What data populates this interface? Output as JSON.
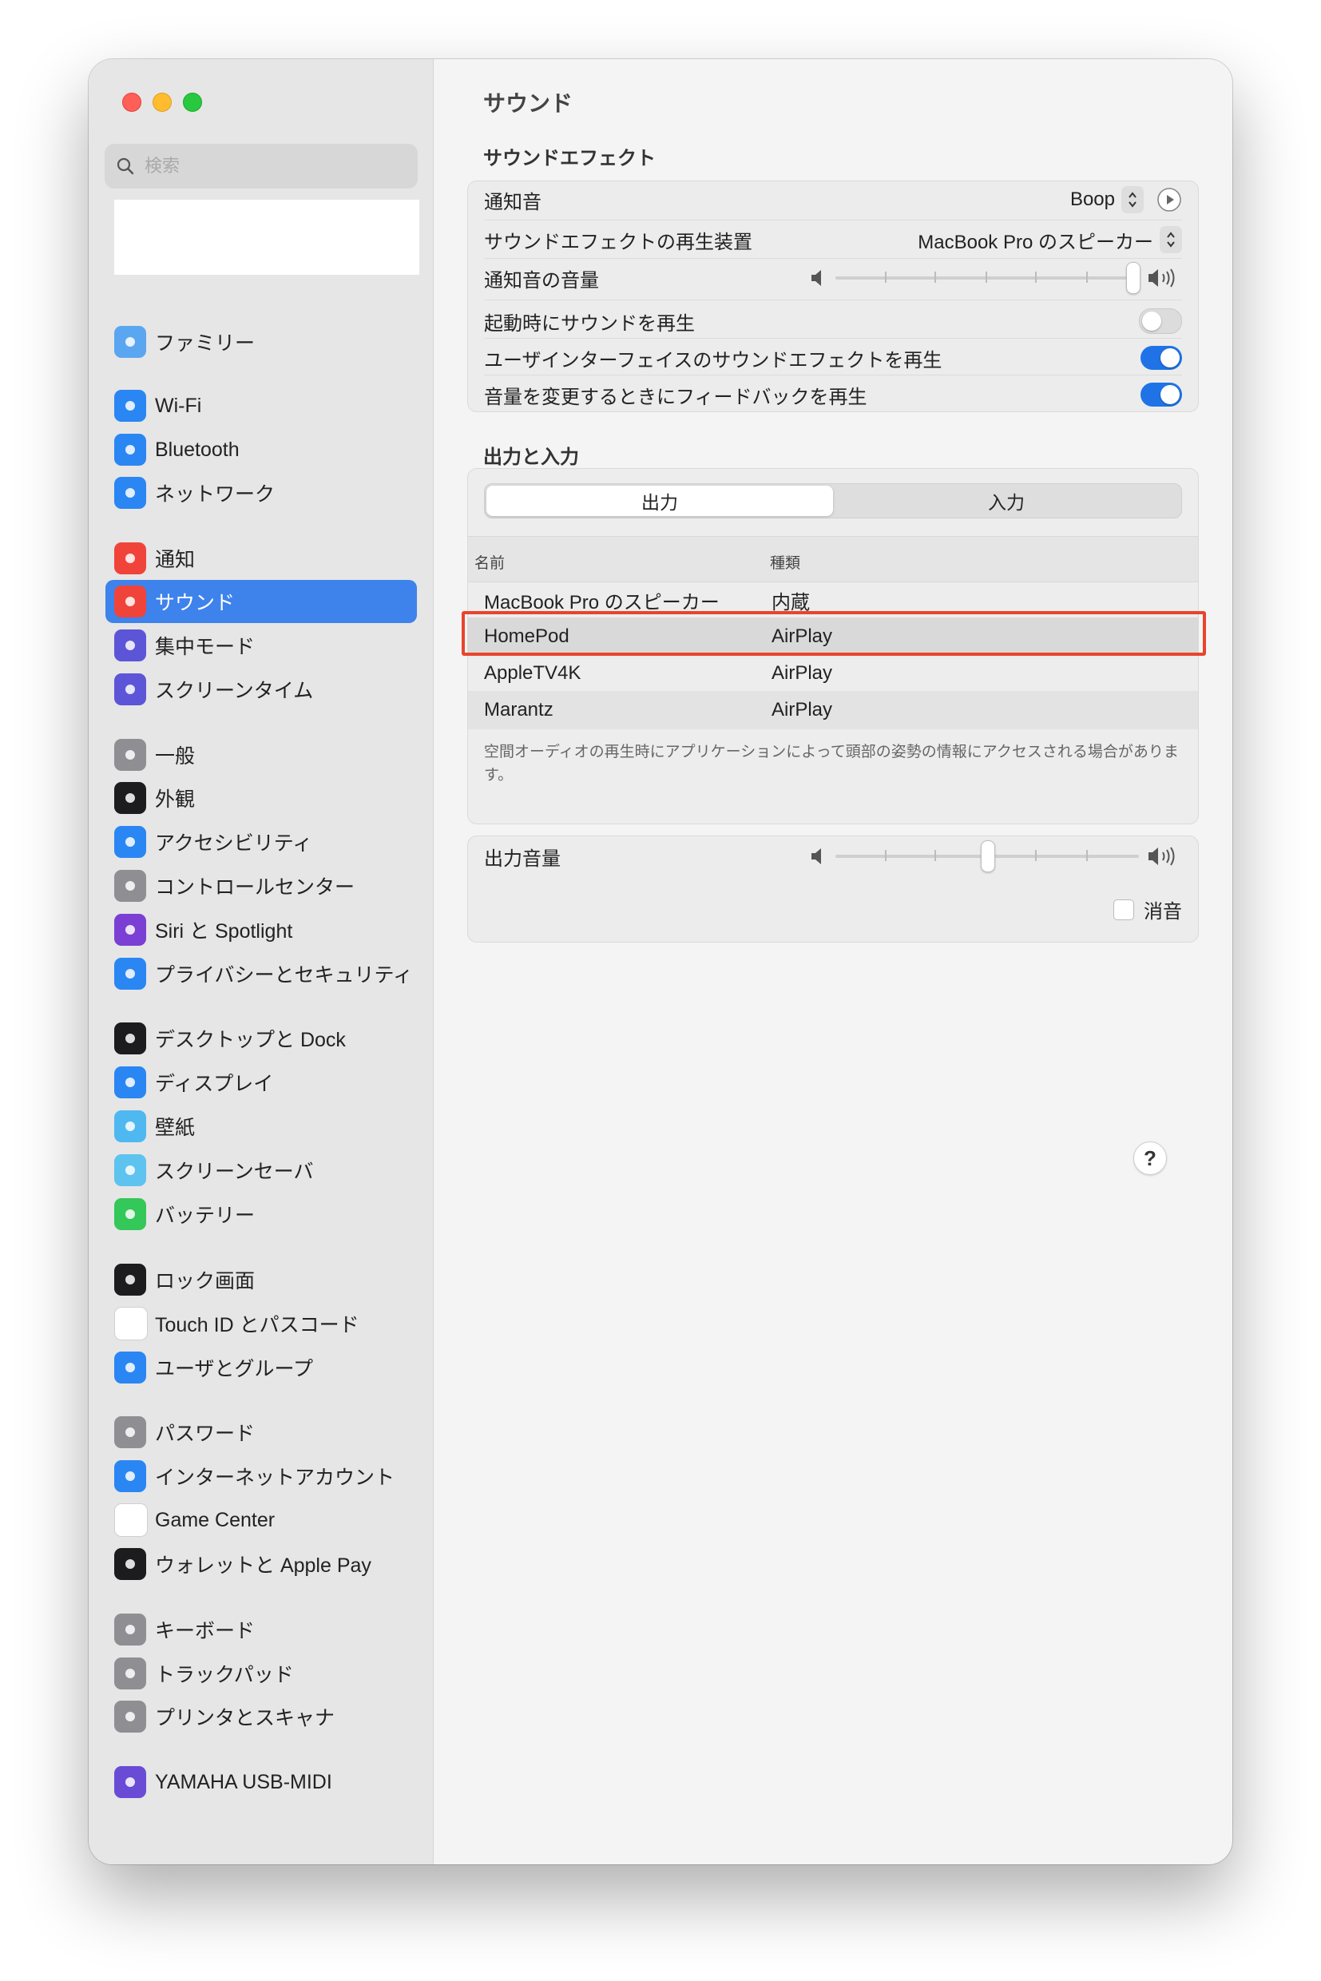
{
  "search": {
    "placeholder": "検索"
  },
  "sidebar": {
    "items": [
      {
        "label": "ファミリー",
        "icon": "family-icon",
        "color": "#5aa6f0"
      },
      {
        "label": "Wi-Fi",
        "icon": "wifi-icon",
        "color": "#2a86f3"
      },
      {
        "label": "Bluetooth",
        "icon": "bluetooth-icon",
        "color": "#2a86f3"
      },
      {
        "label": "ネットワーク",
        "icon": "globe-icon",
        "color": "#2a86f3"
      },
      {
        "label": "通知",
        "icon": "notification-bell-icon",
        "color": "#f0443a"
      },
      {
        "label": "サウンド",
        "icon": "speaker-icon",
        "color": "#f0443a"
      },
      {
        "label": "集中モード",
        "icon": "moon-icon",
        "color": "#5d55d8"
      },
      {
        "label": "スクリーンタイム",
        "icon": "hourglass-icon",
        "color": "#5d55d8"
      },
      {
        "label": "一般",
        "icon": "gear-icon",
        "color": "#8e8e93"
      },
      {
        "label": "外観",
        "icon": "appearance-icon",
        "color": "#1c1c1e"
      },
      {
        "label": "アクセシビリティ",
        "icon": "accessibility-icon",
        "color": "#2a86f3"
      },
      {
        "label": "コントロールセンター",
        "icon": "control-center-icon",
        "color": "#8e8e93"
      },
      {
        "label": "Siri と Spotlight",
        "icon": "siri-icon",
        "color": "#7b3fd4"
      },
      {
        "label": "プライバシーとセキュリティ",
        "icon": "hand-icon",
        "color": "#2a86f3"
      },
      {
        "label": "デスクトップと Dock",
        "icon": "dock-icon",
        "color": "#1c1c1e"
      },
      {
        "label": "ディスプレイ",
        "icon": "brightness-icon",
        "color": "#2a86f3"
      },
      {
        "label": "壁紙",
        "icon": "flower-icon",
        "color": "#4fb8f0"
      },
      {
        "label": "スクリーンセーバ",
        "icon": "screensaver-icon",
        "color": "#5ec3ef"
      },
      {
        "label": "バッテリー",
        "icon": "battery-icon",
        "color": "#34c759"
      },
      {
        "label": "ロック画面",
        "icon": "lock-icon",
        "color": "#1c1c1e"
      },
      {
        "label": "Touch ID とパスコード",
        "icon": "fingerprint-icon",
        "color": "#ffffff"
      },
      {
        "label": "ユーザとグループ",
        "icon": "users-icon",
        "color": "#2a86f3"
      },
      {
        "label": "パスワード",
        "icon": "key-icon",
        "color": "#8e8e93"
      },
      {
        "label": "インターネットアカウント",
        "icon": "at-sign-icon",
        "color": "#2a86f3"
      },
      {
        "label": "Game Center",
        "icon": "game-center-icon",
        "color": "#ffffff"
      },
      {
        "label": "ウォレットと Apple Pay",
        "icon": "wallet-icon",
        "color": "#1c1c1e"
      },
      {
        "label": "キーボード",
        "icon": "keyboard-icon",
        "color": "#8e8e93"
      },
      {
        "label": "トラックパッド",
        "icon": "trackpad-icon",
        "color": "#8e8e93"
      },
      {
        "label": "プリンタとスキャナ",
        "icon": "printer-icon",
        "color": "#8e8e93"
      },
      {
        "label": "YAMAHA USB-MIDI",
        "icon": "yamaha-midi-icon",
        "color": "#6a4bd6"
      }
    ],
    "selected_index": 5,
    "accent": "#3e82ec"
  },
  "main": {
    "title": "サウンド",
    "sound_effects": {
      "header": "サウンドエフェクト",
      "alert_sound_label": "通知音",
      "alert_sound_value": "Boop",
      "play_device_label": "サウンドエフェクトの再生装置",
      "play_device_value": "MacBook Pro のスピーカー",
      "alert_volume_label": "通知音の音量",
      "alert_volume_level": 1.0,
      "startup_sound_label": "起動時にサウンドを再生",
      "startup_sound_on": false,
      "ui_effects_label": "ユーザインターフェイスのサウンドエフェクトを再生",
      "ui_effects_on": true,
      "volume_feedback_label": "音量を変更するときにフィードバックを再生",
      "volume_feedback_on": true
    },
    "output_input": {
      "header": "出力と入力",
      "tabs": [
        "出力",
        "入力"
      ],
      "active_tab": "出力",
      "columns": [
        "名前",
        "種類"
      ],
      "devices": [
        {
          "name": "MacBook Pro のスピーカー",
          "type": "内蔵"
        },
        {
          "name": "HomePod",
          "type": "AirPlay",
          "selected": true
        },
        {
          "name": "AppleTV4K",
          "type": "AirPlay"
        },
        {
          "name": "Marantz",
          "type": "AirPlay"
        }
      ],
      "note": "空間オーディオの再生時にアプリケーションによって頭部の姿勢の情報にアクセスされる場合があります。"
    },
    "output_volume": {
      "label": "出力音量",
      "level": 0.5,
      "mute_label": "消音",
      "muted": false
    },
    "help_label": "?"
  },
  "colors": {
    "toggle_on": "#1f73e6",
    "highlight": "#e8452c"
  }
}
